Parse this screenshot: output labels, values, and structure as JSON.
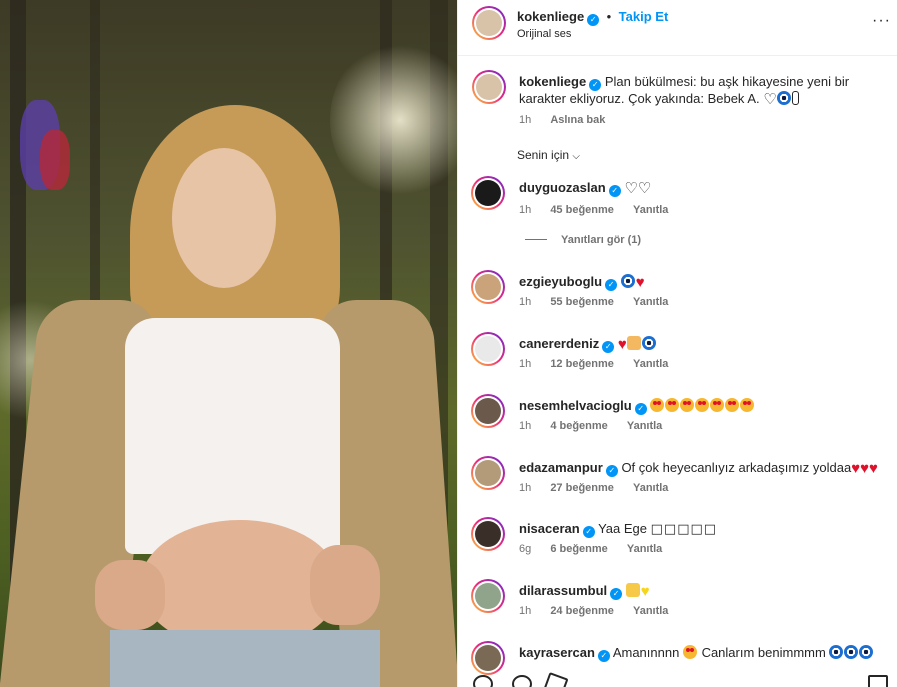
{
  "post": {
    "author": "kokenliege",
    "follow_label": "Takip Et",
    "audio": "Orijinal ses",
    "more_label": "···"
  },
  "caption": {
    "author": "kokenliege",
    "text": "Plan bükülmesi: bu aşk hikayesine yeni bir karakter ekliyoruz. Çok yakında: Bebek A.",
    "time": "1h",
    "translate": "Aslına bak"
  },
  "filter": {
    "label": "Senin için",
    "chevron": "chevron-down-icon"
  },
  "comments": [
    {
      "user": "duyguozaslan",
      "text": "",
      "emojis": [
        "heart-outline",
        "heart-outline"
      ],
      "time": "1h",
      "likes": "45 beğenme",
      "reply": "Yanıtla",
      "avatar_color": "#1a1a1a"
    },
    {
      "user": "ezgieyuboglu",
      "text": "",
      "emojis": [
        "nazar",
        "heart-red"
      ],
      "time": "1h",
      "likes": "55 beğenme",
      "reply": "Yanıtla",
      "avatar_color": "#caa37a"
    },
    {
      "user": "canererdeniz",
      "text": "",
      "emojis": [
        "heart-red",
        "hands",
        "nazar"
      ],
      "time": "1h",
      "likes": "12 beğenme",
      "reply": "Yanıtla",
      "avatar_color": "#e9e9e9"
    },
    {
      "user": "nesemhelvacioglu",
      "text": "",
      "emojis": [
        "heart-eyes",
        "heart-eyes",
        "heart-eyes",
        "heart-eyes",
        "heart-eyes",
        "heart-eyes",
        "heart-eyes"
      ],
      "time": "1h",
      "likes": "4 beğenme",
      "reply": "Yanıtla",
      "avatar_color": "#6b5a4c"
    },
    {
      "user": "edazamanpur",
      "text": "Of çok heyecanlıyız arkadaşımız yoldaa",
      "emojis": [
        "heart-red",
        "heart-red",
        "heart-red"
      ],
      "time": "1h",
      "likes": "27 beğenme",
      "reply": "Yanıtla",
      "avatar_color": "#b39a78"
    },
    {
      "user": "nisaceran",
      "text": "Yaa Ege",
      "boxes": "□□□□□",
      "emojis": [],
      "time": "6g",
      "likes": "6 beğenme",
      "reply": "Yanıtla",
      "avatar_color": "#3a2e28"
    },
    {
      "user": "dilarassumbul",
      "text": "",
      "emojis": [
        "star",
        "yellow-heart"
      ],
      "time": "1h",
      "likes": "24 beğenme",
      "reply": "Yanıtla",
      "avatar_color": "#8fa48a"
    },
    {
      "user": "kayrasercan",
      "text": "Amanınnnn",
      "text2": "Canlarım benimmmm",
      "emojis": [],
      "time": "",
      "likes": "",
      "reply": "",
      "avatar_color": "#7a6a55"
    }
  ],
  "view_replies": "Yanıtları gör (1)"
}
